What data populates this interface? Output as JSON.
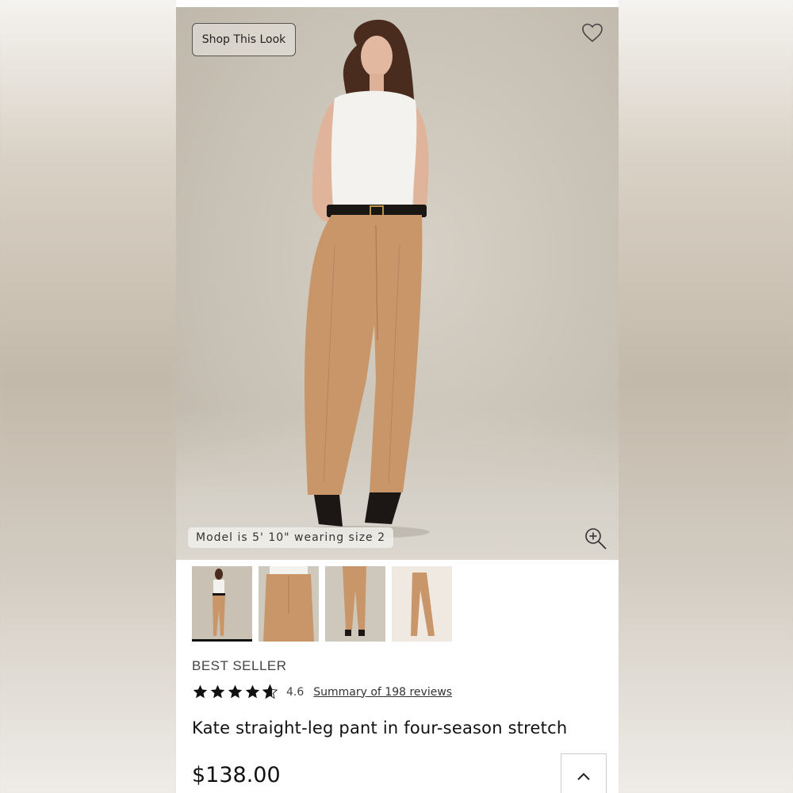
{
  "hero": {
    "shop_look_label": "Shop This Look",
    "model_info": "Model is 5' 10\" wearing size 2",
    "icons": {
      "favorite": "heart-icon",
      "zoom": "zoom-in-icon"
    }
  },
  "thumbnails": [
    {
      "name": "full-look",
      "selected": true
    },
    {
      "name": "front-detail",
      "selected": false
    },
    {
      "name": "back-view",
      "selected": false
    },
    {
      "name": "flat-lay",
      "selected": false
    }
  ],
  "product": {
    "badge": "BEST SELLER",
    "rating_value": "4.6",
    "rating_stars": 4.6,
    "reviews_link": "Summary of 198 reviews",
    "title": "Kate straight-leg pant in four-season stretch",
    "price": "$138.00"
  },
  "colors": {
    "pant": "#c9966a",
    "top": "#f4f2ee",
    "text": "#111111"
  }
}
